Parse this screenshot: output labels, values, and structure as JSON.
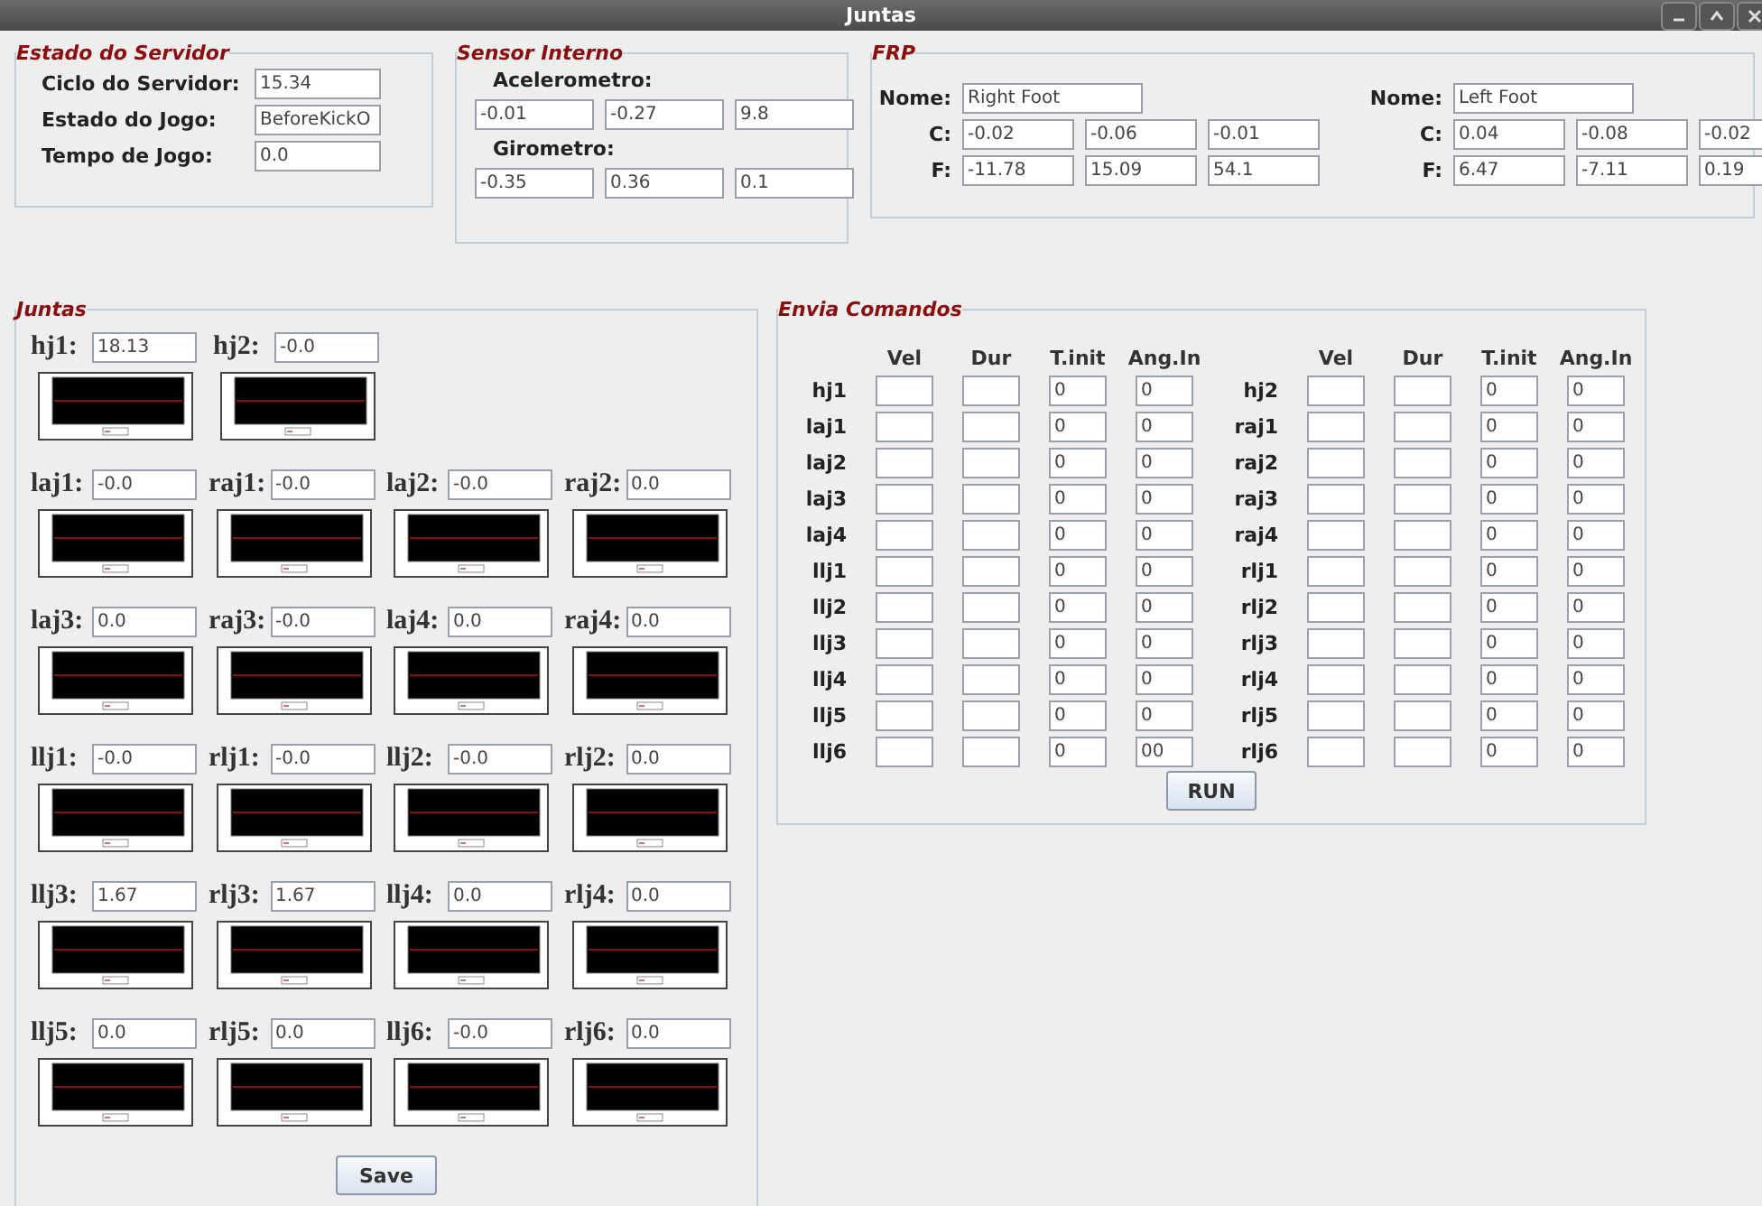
{
  "window": {
    "title": "Juntas"
  },
  "servidor": {
    "title": "Estado do Servidor",
    "fields": [
      {
        "label": "Ciclo do Servidor:",
        "value": "15.34"
      },
      {
        "label": "Estado do Jogo:",
        "value": "BeforeKickO"
      },
      {
        "label": "Tempo de Jogo:",
        "value": "0.0"
      }
    ]
  },
  "sensor": {
    "title": "Sensor Interno",
    "groups": [
      {
        "label": "Acelerometro:",
        "values": [
          "-0.01",
          "-0.27",
          "9.8"
        ]
      },
      {
        "label": "Girometro:",
        "values": [
          "-0.35",
          "0.36",
          "0.1"
        ]
      }
    ]
  },
  "frp": {
    "title": "FRP",
    "feet": [
      {
        "name_label": "Nome:",
        "name": "Right Foot",
        "rows": [
          {
            "label": "C:",
            "values": [
              "-0.02",
              "-0.06",
              "-0.01"
            ]
          },
          {
            "label": "F:",
            "values": [
              "-11.78",
              "15.09",
              "54.1"
            ]
          }
        ]
      },
      {
        "name_label": "Nome:",
        "name": "Left Foot",
        "rows": [
          {
            "label": "C:",
            "values": [
              "0.04",
              "-0.08",
              "-0.02"
            ]
          },
          {
            "label": "F:",
            "values": [
              "6.47",
              "-7.11",
              "0.19"
            ]
          }
        ]
      }
    ]
  },
  "juntas": {
    "title": "Juntas",
    "rows": [
      [
        {
          "label": "hj1:",
          "value": "18.13"
        },
        {
          "label": "hj2:",
          "value": "-0.0"
        }
      ],
      [
        {
          "label": "laj1:",
          "value": "-0.0"
        },
        {
          "label": "raj1:",
          "value": "-0.0"
        },
        {
          "label": "laj2:",
          "value": "-0.0"
        },
        {
          "label": "raj2:",
          "value": "0.0"
        }
      ],
      [
        {
          "label": "laj3:",
          "value": "0.0"
        },
        {
          "label": "raj3:",
          "value": "-0.0"
        },
        {
          "label": "laj4:",
          "value": "0.0"
        },
        {
          "label": "raj4:",
          "value": "0.0"
        }
      ],
      [
        {
          "label": "llj1:",
          "value": "-0.0"
        },
        {
          "label": "rlj1:",
          "value": "-0.0"
        },
        {
          "label": "llj2:",
          "value": "-0.0"
        },
        {
          "label": "rlj2:",
          "value": "0.0"
        }
      ],
      [
        {
          "label": "llj3:",
          "value": "1.67"
        },
        {
          "label": "rlj3:",
          "value": "1.67"
        },
        {
          "label": "llj4:",
          "value": "0.0"
        },
        {
          "label": "rlj4:",
          "value": "0.0"
        }
      ],
      [
        {
          "label": "llj5:",
          "value": "0.0"
        },
        {
          "label": "rlj5:",
          "value": "0.0"
        },
        {
          "label": "llj6:",
          "value": "-0.0"
        },
        {
          "label": "rlj6:",
          "value": "0.0"
        }
      ]
    ],
    "button": "Save"
  },
  "comandos": {
    "title": "Envia Comandos",
    "columns_left": [
      "Vel",
      "Dur",
      "T.init",
      "Ang.In"
    ],
    "columns_right": [
      "Vel",
      "Dur",
      "T.init",
      "Ang.In"
    ],
    "rows": [
      {
        "left": {
          "label": "hj1",
          "t_init": "0",
          "ang_in": "0"
        },
        "right": {
          "label": "hj2",
          "t_init": "0",
          "ang_in": "0"
        }
      },
      {
        "left": {
          "label": "laj1",
          "t_init": "0",
          "ang_in": "0"
        },
        "right": {
          "label": "raj1",
          "t_init": "0",
          "ang_in": "0"
        }
      },
      {
        "left": {
          "label": "laj2",
          "t_init": "0",
          "ang_in": "0"
        },
        "right": {
          "label": "raj2",
          "t_init": "0",
          "ang_in": "0"
        }
      },
      {
        "left": {
          "label": "laj3",
          "t_init": "0",
          "ang_in": "0"
        },
        "right": {
          "label": "raj3",
          "t_init": "0",
          "ang_in": "0"
        }
      },
      {
        "left": {
          "label": "laj4",
          "t_init": "0",
          "ang_in": "0"
        },
        "right": {
          "label": "raj4",
          "t_init": "0",
          "ang_in": "0"
        }
      },
      {
        "left": {
          "label": "llj1",
          "t_init": "0",
          "ang_in": "0"
        },
        "right": {
          "label": "rlj1",
          "t_init": "0",
          "ang_in": "0"
        }
      },
      {
        "left": {
          "label": "llj2",
          "t_init": "0",
          "ang_in": "0"
        },
        "right": {
          "label": "rlj2",
          "t_init": "0",
          "ang_in": "0"
        }
      },
      {
        "left": {
          "label": "llj3",
          "t_init": "0",
          "ang_in": "0"
        },
        "right": {
          "label": "rlj3",
          "t_init": "0",
          "ang_in": "0"
        }
      },
      {
        "left": {
          "label": "llj4",
          "t_init": "0",
          "ang_in": "0"
        },
        "right": {
          "label": "rlj4",
          "t_init": "0",
          "ang_in": "0"
        }
      },
      {
        "left": {
          "label": "llj5",
          "t_init": "0",
          "ang_in": "0"
        },
        "right": {
          "label": "rlj5",
          "t_init": "0",
          "ang_in": "0"
        }
      },
      {
        "left": {
          "label": "llj6",
          "t_init": "0",
          "ang_in": "00"
        },
        "right": {
          "label": "rlj6",
          "t_init": "0",
          "ang_in": "0"
        }
      }
    ],
    "button": "RUN"
  }
}
